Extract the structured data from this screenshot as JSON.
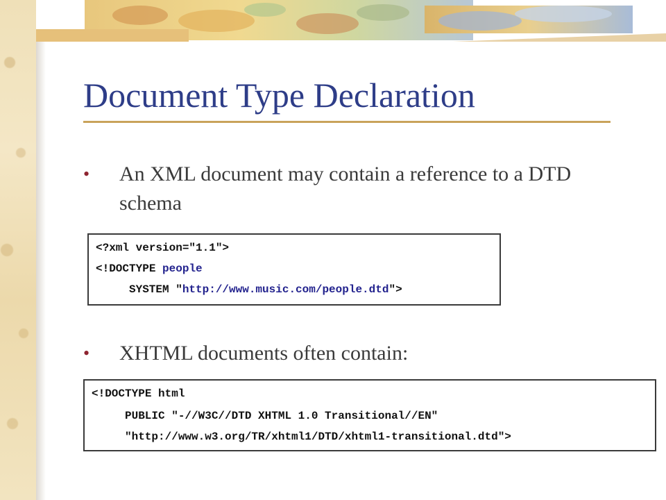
{
  "slide": {
    "title": "Document Type Declaration",
    "bullet_marker": "•",
    "bullets": [
      {
        "text": "An XML document may contain a reference to a DTD schema"
      },
      {
        "text": "XHTML documents often contain:"
      }
    ],
    "code1": {
      "line1": "<?xml version=\"1.1\">",
      "line2_keyword": "<!DOCTYPE",
      "line2_name": "people",
      "line3_prefix": "SYSTEM \"",
      "line3_url": "http://www.music.com/people.dtd",
      "line3_suffix": "\">"
    },
    "code2": {
      "line1": "<!DOCTYPE html",
      "line2": "PUBLIC \"-//W3C//DTD XHTML 1.0 Transitional//EN\"",
      "line3": "\"http://www.w3.org/TR/xhtml1/DTD/xhtml1-transitional.dtd\">"
    }
  },
  "colors": {
    "title": "#2e3d88",
    "rule": "#c9a35b",
    "bullet_dot": "#8e2430",
    "body_text": "#3a3a3a",
    "code_blue": "#23238e"
  }
}
